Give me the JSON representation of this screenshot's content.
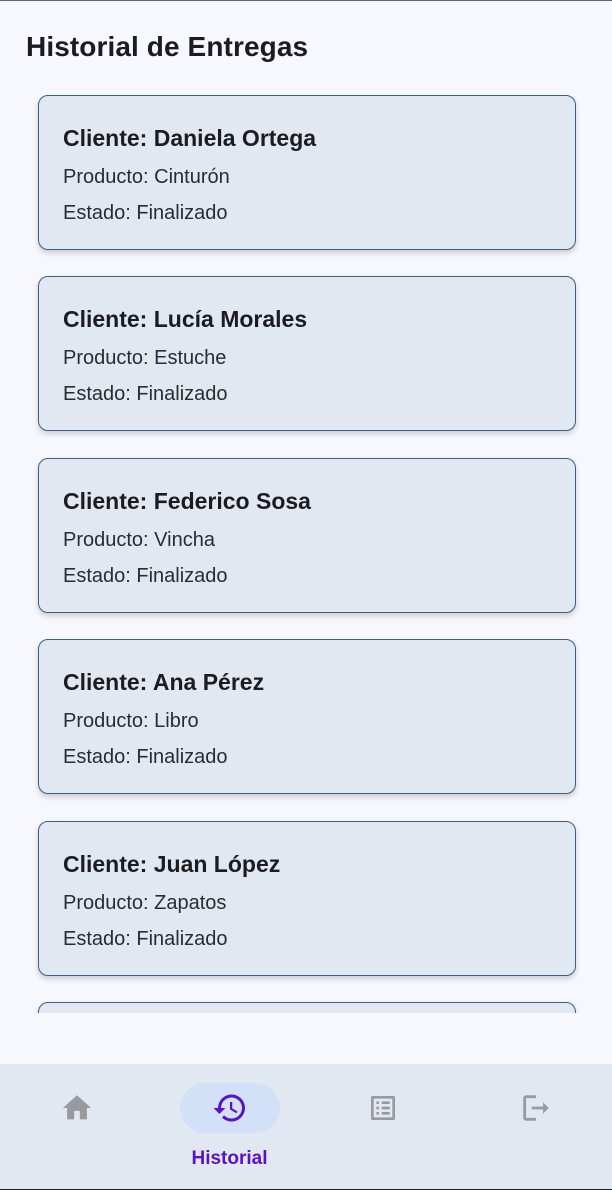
{
  "header": {
    "title": "Historial de Entregas"
  },
  "deliveries": [
    {
      "client": "Cliente: Daniela Ortega",
      "product": "Producto: Cinturón",
      "status": "Estado: Finalizado"
    },
    {
      "client": "Cliente: Lucía Morales",
      "product": "Producto: Estuche",
      "status": "Estado: Finalizado"
    },
    {
      "client": "Cliente: Federico Sosa",
      "product": "Producto: Vincha",
      "status": "Estado: Finalizado"
    },
    {
      "client": "Cliente: Ana Pérez",
      "product": "Producto: Libro",
      "status": "Estado: Finalizado"
    },
    {
      "client": "Cliente: Juan López",
      "product": "Producto: Zapatos",
      "status": "Estado: Finalizado"
    }
  ],
  "bottom_nav": {
    "items": [
      {
        "icon": "home-icon",
        "label": ""
      },
      {
        "icon": "history-icon",
        "label": "Historial",
        "active": true
      },
      {
        "icon": "list-document-icon",
        "label": ""
      },
      {
        "icon": "logout-icon",
        "label": ""
      }
    ]
  },
  "colors": {
    "background": "#f7f8fd",
    "card": "#e2e8f1",
    "card_border": "#3d5f86",
    "active_accent": "#5a12c7",
    "active_pill": "#d3e1f8",
    "inactive_icon": "#9a9a9e"
  }
}
